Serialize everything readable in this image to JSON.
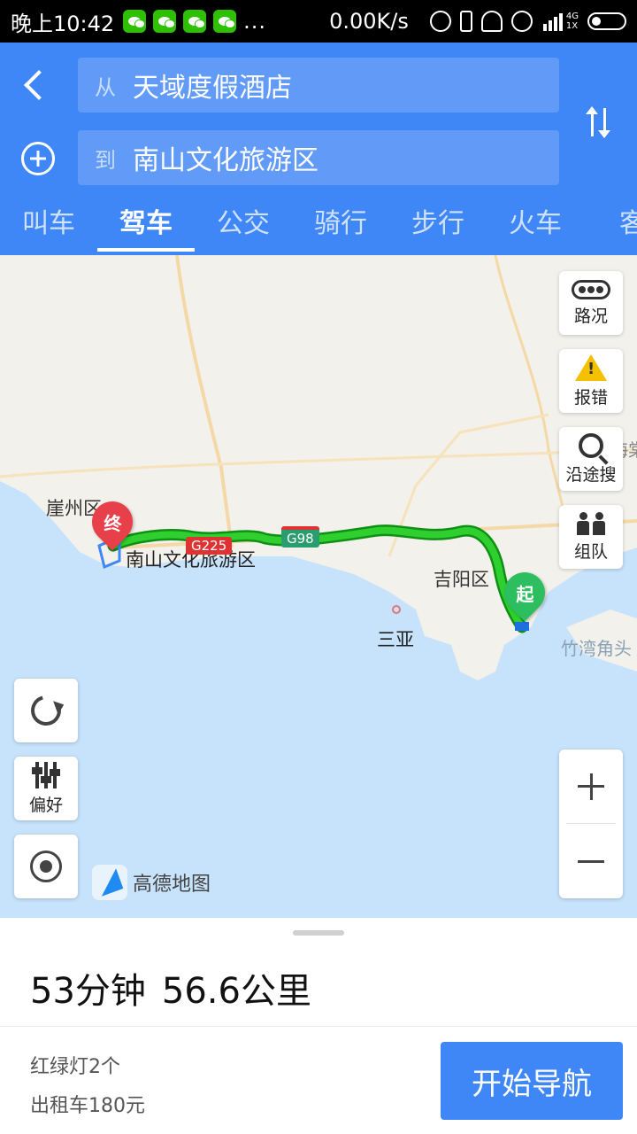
{
  "status_bar": {
    "time": "晚上10:42",
    "more": "...",
    "speed": "0.00K/s",
    "network": "4G",
    "sim": "1X"
  },
  "route_input": {
    "from_prefix": "从",
    "from_value": "天域度假酒店",
    "to_prefix": "到",
    "to_value": "南山文化旅游区"
  },
  "tabs": [
    {
      "label": "叫车"
    },
    {
      "label": "驾车"
    },
    {
      "label": "公交"
    },
    {
      "label": "骑行"
    },
    {
      "label": "步行"
    },
    {
      "label": "火车"
    },
    {
      "label": "客"
    }
  ],
  "active_tab": "驾车",
  "map": {
    "labels": {
      "yazhou": "崖州区",
      "destination": "南山文化旅游区",
      "jiyang": "吉阳区",
      "sanya": "三亚",
      "zhuwan": "竹湾角头",
      "haitang": "海棠"
    },
    "shields": {
      "g98": "G98",
      "g225": "G225"
    },
    "start_pin": "起",
    "end_pin": "终",
    "route_color": "#1fb524",
    "logo_text": "高德地图"
  },
  "map_controls": {
    "traffic": "路况",
    "report": "报错",
    "search_along": "沿途搜",
    "team": "组队",
    "preference": "偏好"
  },
  "summary": {
    "duration": "53分钟",
    "distance": "56.6公里",
    "traffic_lights": "红绿灯2个",
    "taxi": "出租车180元"
  },
  "navigate_button": "开始导航",
  "colors": {
    "brand_blue": "#3f86f6",
    "start_green": "#2dbf5f",
    "end_red": "#e8404a"
  }
}
